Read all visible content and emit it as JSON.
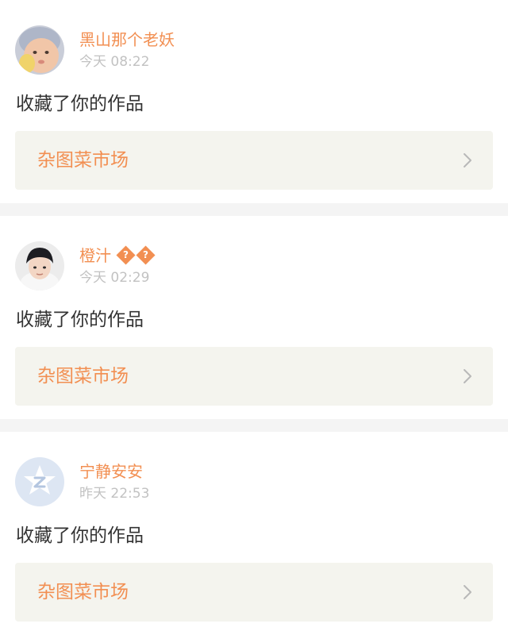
{
  "notifications": [
    {
      "username": "黑山那个老妖",
      "badges": [],
      "time": "今天 08:22",
      "action": "收藏了你的作品",
      "work_title": "杂图菜市场",
      "avatar_icon": "baby-photo-avatar"
    },
    {
      "username": "橙汁",
      "badges": [
        "?",
        "?"
      ],
      "time": "今天 02:29",
      "action": "收藏了你的作品",
      "work_title": "杂图菜市场",
      "avatar_icon": "person-photo-avatar"
    },
    {
      "username": "宁静安安",
      "badges": [],
      "time": "昨天 22:53",
      "action": "收藏了你的作品",
      "work_title": "杂图菜市场",
      "avatar_icon": "default-star-avatar"
    }
  ],
  "colors": {
    "accent": "#f28f52",
    "time_text": "#c2c2c2",
    "body_text": "#333333",
    "link_box": "#f4f4ee",
    "divider": "#f4f4f4"
  }
}
